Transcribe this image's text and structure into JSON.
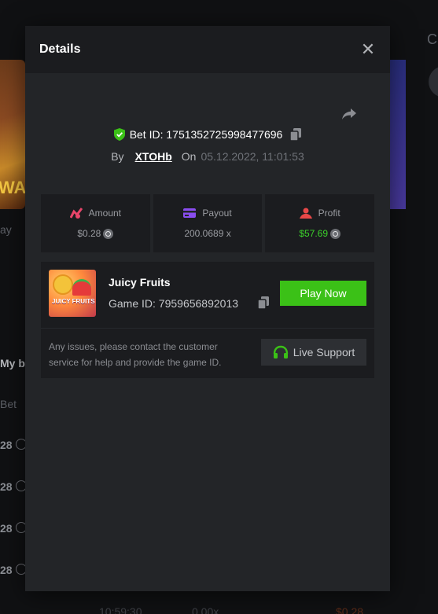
{
  "background": {
    "left_label": "ay",
    "section_label": "My be",
    "bet_col_label": "Bet",
    "row_values": [
      "28",
      "28",
      "28",
      "28"
    ],
    "bottom_time": "10:59:30",
    "bottom_payout": "0.00x",
    "bottom_amount": "$0.28",
    "right_letter": "C"
  },
  "modal": {
    "title": "Details",
    "bet_id": "Bet ID: 1751352725998477696",
    "by_label": "By",
    "username": "XTOHb",
    "on_label": "On",
    "date": "05.12.2022, 11:01:53",
    "stats": {
      "amount_label": "Amount",
      "amount_value": "$0.28",
      "payout_label": "Payout",
      "payout_value": "200.0689 x",
      "profit_label": "Profit",
      "profit_value": "$57.69"
    },
    "game": {
      "name": "Juicy Fruits",
      "id": "Game ID: 7959656892013",
      "thumb_text": "JUICY FRUITS",
      "play_label": "Play Now"
    },
    "support": {
      "text": "Any issues, please contact the customer service for help and provide the game ID.",
      "button_label": "Live Support"
    }
  },
  "colors": {
    "accent_green": "#3bc117",
    "profit_green": "#3bd22a",
    "amount_icon": "#e8456a",
    "payout_icon": "#8a4df0",
    "profit_icon": "#e84848"
  }
}
